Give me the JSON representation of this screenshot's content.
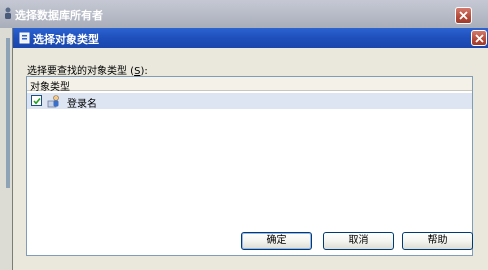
{
  "parent_window": {
    "title": "选择数据库所有者",
    "icon": "user-group-icon"
  },
  "dialog": {
    "title": "选择对象类型",
    "icon": "object-type-icon",
    "prompt": {
      "before": "选择要查找的对象类型 (",
      "mnemonic": "S",
      "after": "):"
    },
    "list": {
      "column_header": "对象类型",
      "items": [
        {
          "label": "登录名",
          "checked": true,
          "icon": "login-user-icon"
        }
      ]
    },
    "buttons": {
      "ok": "确定",
      "cancel": "取消",
      "help": "帮助"
    }
  },
  "colors": {
    "title_bar_active": "#2458c4",
    "title_bar_inactive": "#b6bac6",
    "close_button": "#b34a39",
    "dialog_face": "#eae8dc",
    "selected_row": "#dde4f2"
  }
}
